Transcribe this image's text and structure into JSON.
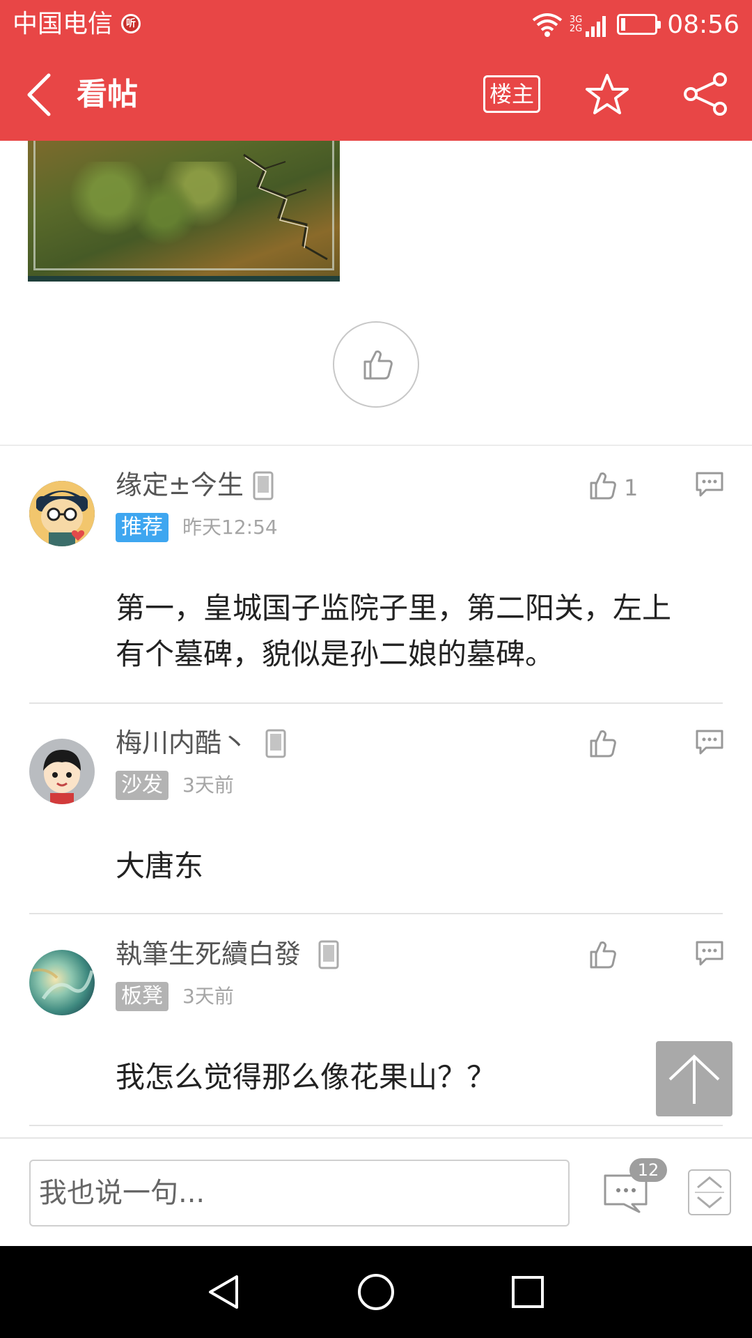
{
  "status_bar": {
    "carrier": "中国电信",
    "badge": "听",
    "network_top": "3G",
    "network_bottom": "2G",
    "time": "08:56",
    "battery_level": 0.1
  },
  "header": {
    "title": "看帖",
    "owner_button": "楼主",
    "icons": [
      "back-arrow-icon",
      "star-icon",
      "share-icon"
    ],
    "background_color": "#e84646"
  },
  "comments": [
    {
      "username": "缘定±今生",
      "tag": "推荐",
      "tag_color": "#3ea6f0",
      "time": "昨天12:54",
      "like_count": "1",
      "content_lines": [
        "第一，皇城国子监院子里，第二阳关，左上",
        "有个墓碑，貌似是孙二娘的墓碑。"
      ]
    },
    {
      "username": "梅川内酷丶",
      "tag": "沙发",
      "tag_color": "#b3b3b3",
      "time": "3天前",
      "like_count": "",
      "content_lines": [
        "大唐东"
      ]
    },
    {
      "username": "執筆生死續白發",
      "tag": "板凳",
      "tag_color": "#b3b3b3",
      "time": "3天前",
      "like_count": "",
      "content_lines": [
        "我怎么觉得那么像花果山？？"
      ]
    }
  ],
  "input_bar": {
    "placeholder": "我也说一句...",
    "comment_count": "12"
  },
  "nav_bar": {
    "icons": [
      "nav-back-icon",
      "nav-home-icon",
      "nav-recent-icon"
    ]
  }
}
